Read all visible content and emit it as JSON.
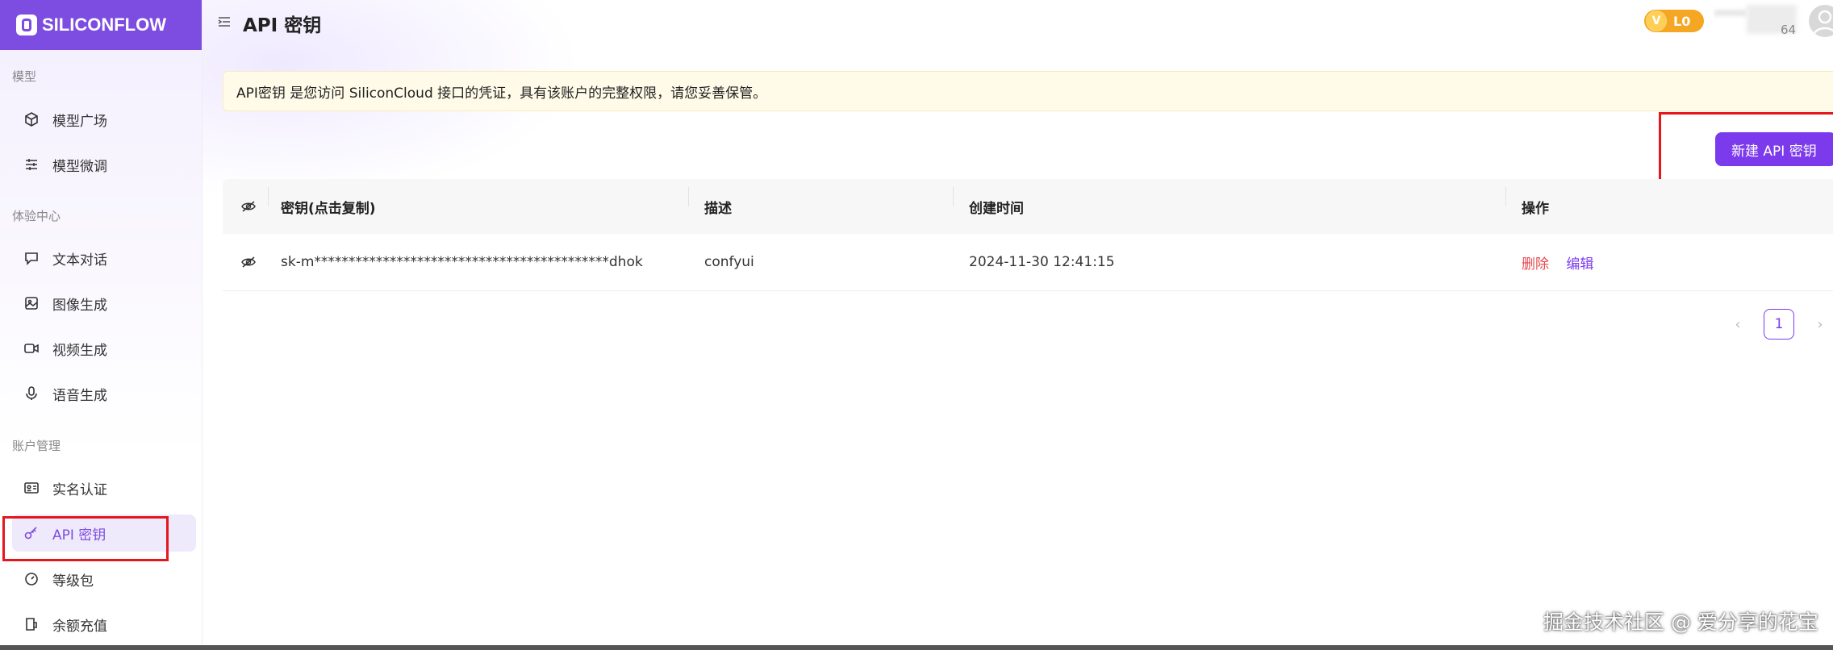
{
  "brand": {
    "logo_text": "SILICONFLOW",
    "accent": "#7c3aed",
    "sidebar_header": "#7c4de0"
  },
  "sidebar": {
    "sections": [
      {
        "label": "模型",
        "items": [
          {
            "label": "模型广场",
            "icon": "cube-icon"
          },
          {
            "label": "模型微调",
            "icon": "sliders-icon"
          }
        ]
      },
      {
        "label": "体验中心",
        "items": [
          {
            "label": "文本对话",
            "icon": "chat-icon"
          },
          {
            "label": "图像生成",
            "icon": "image-icon"
          },
          {
            "label": "视频生成",
            "icon": "video-icon"
          },
          {
            "label": "语音生成",
            "icon": "microphone-icon"
          }
        ]
      },
      {
        "label": "账户管理",
        "items": [
          {
            "label": "实名认证",
            "icon": "id-card-icon"
          },
          {
            "label": "API 密钥",
            "icon": "key-icon",
            "active": true
          },
          {
            "label": "等级包",
            "icon": "gauge-icon"
          },
          {
            "label": "余额充值",
            "icon": "wallet-icon"
          }
        ]
      }
    ]
  },
  "header": {
    "title": "API 密钥",
    "level_badge": "L0",
    "level_icon": "V",
    "user_partial": "64"
  },
  "notice": {
    "text": "API密钥 是您访问 SiliconCloud 接口的凭证，具有该账户的完整权限，请您妥善保管。"
  },
  "actions": {
    "new_key": "新建 API 密钥"
  },
  "table": {
    "columns": [
      "密钥(点击复制)",
      "描述",
      "创建时间",
      "操作"
    ],
    "rows": [
      {
        "key": "sk-m*******************************************dhok",
        "description": "confyui",
        "created": "2024-11-30 12:41:15",
        "delete": "删除",
        "edit": "编辑"
      }
    ]
  },
  "pagination": {
    "current": "1"
  },
  "watermark": "掘金技术社区 @ 爱分享的花宝"
}
